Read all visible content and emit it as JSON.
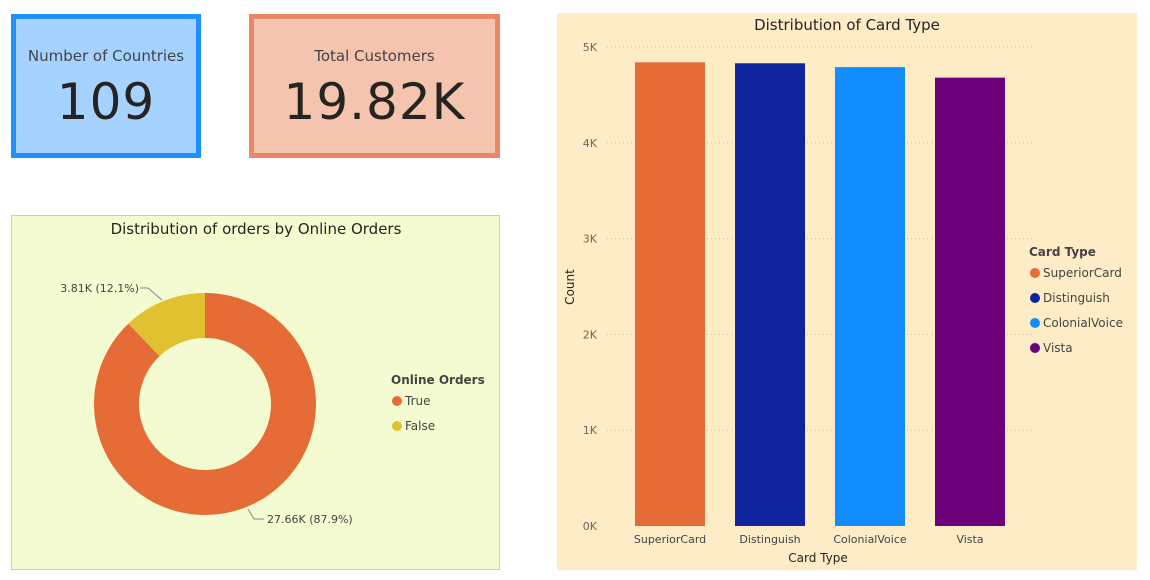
{
  "kpis": {
    "countries": {
      "label": "Number of Countries",
      "value": "109"
    },
    "customers": {
      "label": "Total Customers",
      "value": "19.82K"
    }
  },
  "chart_data": [
    {
      "type": "pie",
      "subtype": "donut",
      "title": "Distribution of orders by Online Orders",
      "legend_title": "Online Orders",
      "legend_position": "right",
      "slices": [
        {
          "label": "True",
          "value": 27.66,
          "display": "27.66K (87.9%)",
          "color": "#e66c37"
        },
        {
          "label": "False",
          "value": 3.81,
          "display": "3.81K (12.1%)",
          "color": "#e0c131"
        }
      ]
    },
    {
      "type": "bar",
      "title": "Distribution of Card Type",
      "xlabel": "Card Type",
      "ylabel": "Count",
      "legend_title": "Card Type",
      "legend_position": "right",
      "ylim": [
        0,
        5000
      ],
      "yticks": [
        0,
        1000,
        2000,
        3000,
        4000,
        5000
      ],
      "ytick_labels": [
        "0K",
        "1K",
        "2K",
        "3K",
        "4K",
        "5K"
      ],
      "grid": true,
      "categories": [
        "SuperiorCard",
        "Distinguish",
        "ColonialVoice",
        "Vista"
      ],
      "values": [
        4840,
        4830,
        4790,
        4680
      ],
      "colors": [
        "#e66c37",
        "#12239e",
        "#118dff",
        "#6b007b"
      ]
    }
  ]
}
